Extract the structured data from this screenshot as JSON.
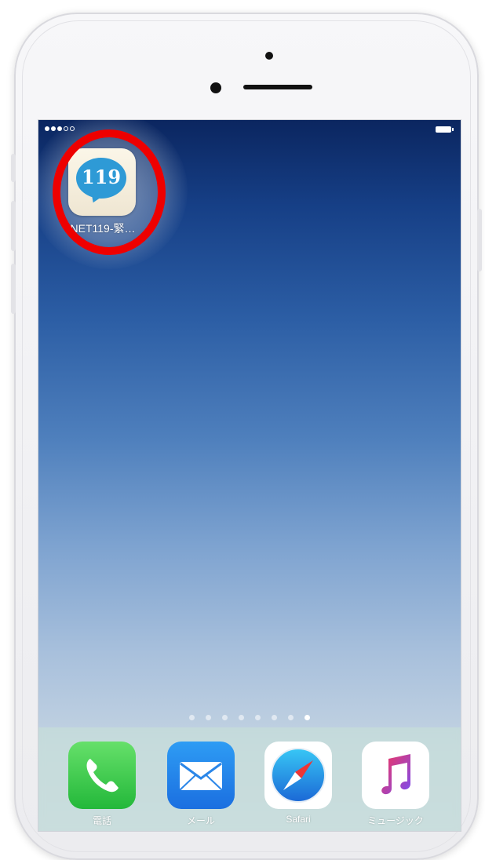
{
  "status_bar": {
    "signal_icon": "signal-dots-icon",
    "battery_icon": "battery-icon"
  },
  "home_screen": {
    "apps": [
      {
        "label": "NET119-緊…",
        "icon": "net119-app-icon",
        "icon_text": "119",
        "highlighted": true,
        "highlight_color": "#ee0000"
      }
    ],
    "page_dots": {
      "count": 8,
      "active_index": 7
    }
  },
  "dock": {
    "apps": [
      {
        "label": "電話",
        "icon": "phone-icon"
      },
      {
        "label": "メール",
        "icon": "mail-icon"
      },
      {
        "label": "Safari",
        "icon": "safari-icon"
      },
      {
        "label": "ミュージック",
        "icon": "music-icon"
      }
    ]
  },
  "colors": {
    "wallpaper_top": "#0b2660",
    "wallpaper_bottom": "#cad8e4",
    "app_bubble": "#2e9ad6",
    "highlight": "#ee0000"
  }
}
